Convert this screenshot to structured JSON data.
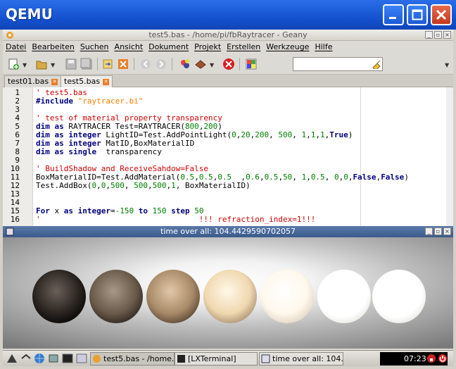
{
  "qemu": {
    "title": "QEMU"
  },
  "geany": {
    "title": "test5.bas - /home/pi/fbRaytracer - Geany",
    "menu": [
      "Datei",
      "Bearbeiten",
      "Suchen",
      "Ansicht",
      "Dokument",
      "Projekt",
      "Erstellen",
      "Werkzeuge",
      "Hilfe"
    ],
    "search_value": "",
    "tabs": [
      "test01.bas",
      "test5.bas"
    ],
    "lines": [
      {
        "n": "1",
        "text": "' test5.bas"
      },
      {
        "n": "2",
        "text": "#include \"raytracer.bi\""
      },
      {
        "n": "3",
        "text": ""
      },
      {
        "n": "4",
        "text": "' test of material property transparency"
      },
      {
        "n": "5",
        "text": "dim as RAYTRACER Test=RAYTRACER(800,200)"
      },
      {
        "n": "6",
        "text": "dim as integer LightID=Test.AddPointLight(0,20,200, 500, 1,1,1,True)"
      },
      {
        "n": "7",
        "text": "dim as integer MatID,BoxMaterialID"
      },
      {
        "n": "8",
        "text": "dim as single  transparency"
      },
      {
        "n": "9",
        "text": ""
      },
      {
        "n": "10",
        "text": "' BuildShadow and ReceiveSahdow=False"
      },
      {
        "n": "11",
        "text": "BoxMaterialID=Test.AddMaterial(0.5,0.5,0.5  ,0.6,0.5,50, 1,0.5, 0,0,False,False)"
      },
      {
        "n": "12",
        "text": "Test.AddBox(0,0,500, 500,500,1, BoxMaterialID)"
      },
      {
        "n": "13",
        "text": ""
      },
      {
        "n": "14",
        "text": ""
      },
      {
        "n": "15",
        "text": "For x as integer=-150 to 150 step 50"
      },
      {
        "n": "16",
        "text": "'                                  !!! refraction_index=1!!!"
      }
    ]
  },
  "render_window": {
    "title": "time over all: 104.4429590702057"
  },
  "taskbar": {
    "tasks": [
      "test5.bas - /home...",
      "[LXTerminal]",
      "time over all: 104..."
    ],
    "clock": "07:23"
  },
  "colors": {
    "qemu_blue": "#1552d0",
    "keyword": "#00007f",
    "comment": "#d00000",
    "string": "#ff7f00",
    "number": "#007f00"
  }
}
